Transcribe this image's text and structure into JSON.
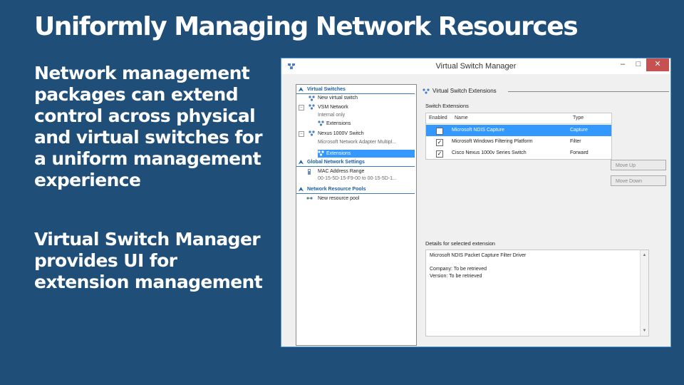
{
  "slide": {
    "title": "Uniformly Managing Network Resources",
    "bullets": [
      "Network management packages can extend control across physical and virtual switches for a uniform management experience",
      "Virtual Switch Manager provides UI for extension management"
    ]
  },
  "window": {
    "title": "Virtual Switch Manager",
    "controls": {
      "minimize": "–",
      "maximize": "□",
      "close": "✕"
    }
  },
  "tree": {
    "virtual_switches": "Virtual Switches",
    "new_virtual_switch": "New virtual switch",
    "vsm_network": "VSM Network",
    "internal_only": "Internal only",
    "extensions": "Extensions",
    "nexus_switch": "Nexus 1000V Switch",
    "adapter": "Microsoft Network Adapter Multipl...",
    "extensions_selected": "Extensions",
    "global_settings": "Global Network Settings",
    "mac_range_label": "MAC Address Range",
    "mac_range_value": "00-15-5D-15-F9-00 to 00-15-5D-1...",
    "resource_pools": "Network Resource Pools",
    "new_resource_pool": "New resource pool"
  },
  "right": {
    "header": "Virtual Switch Extensions",
    "switch_extensions_label": "Switch Extensions",
    "columns": {
      "enabled": "Enabled",
      "name": "Name",
      "type": "Type"
    },
    "extensions": [
      {
        "enabled": false,
        "name": "Microsoft NDIS Capture",
        "type": "Capture"
      },
      {
        "enabled": true,
        "name": "Microsoft Windows Filtering Platform",
        "type": "Filter"
      },
      {
        "enabled": true,
        "name": "Cisco Nexus 1000v Series Switch",
        "type": "Forward"
      }
    ],
    "move_up": "Move Up",
    "move_down": "Move Down",
    "details_label": "Details for selected extension",
    "details_name": "Microsoft NDIS Packet Capture Filter Driver",
    "details_company": "Company: To be retrieved",
    "details_version": "Version: To be retrieved"
  },
  "colors": {
    "background": "#1F4E79",
    "selection": "#3399ff",
    "section_header": "#1c5ea8",
    "close_button": "#c75050"
  }
}
